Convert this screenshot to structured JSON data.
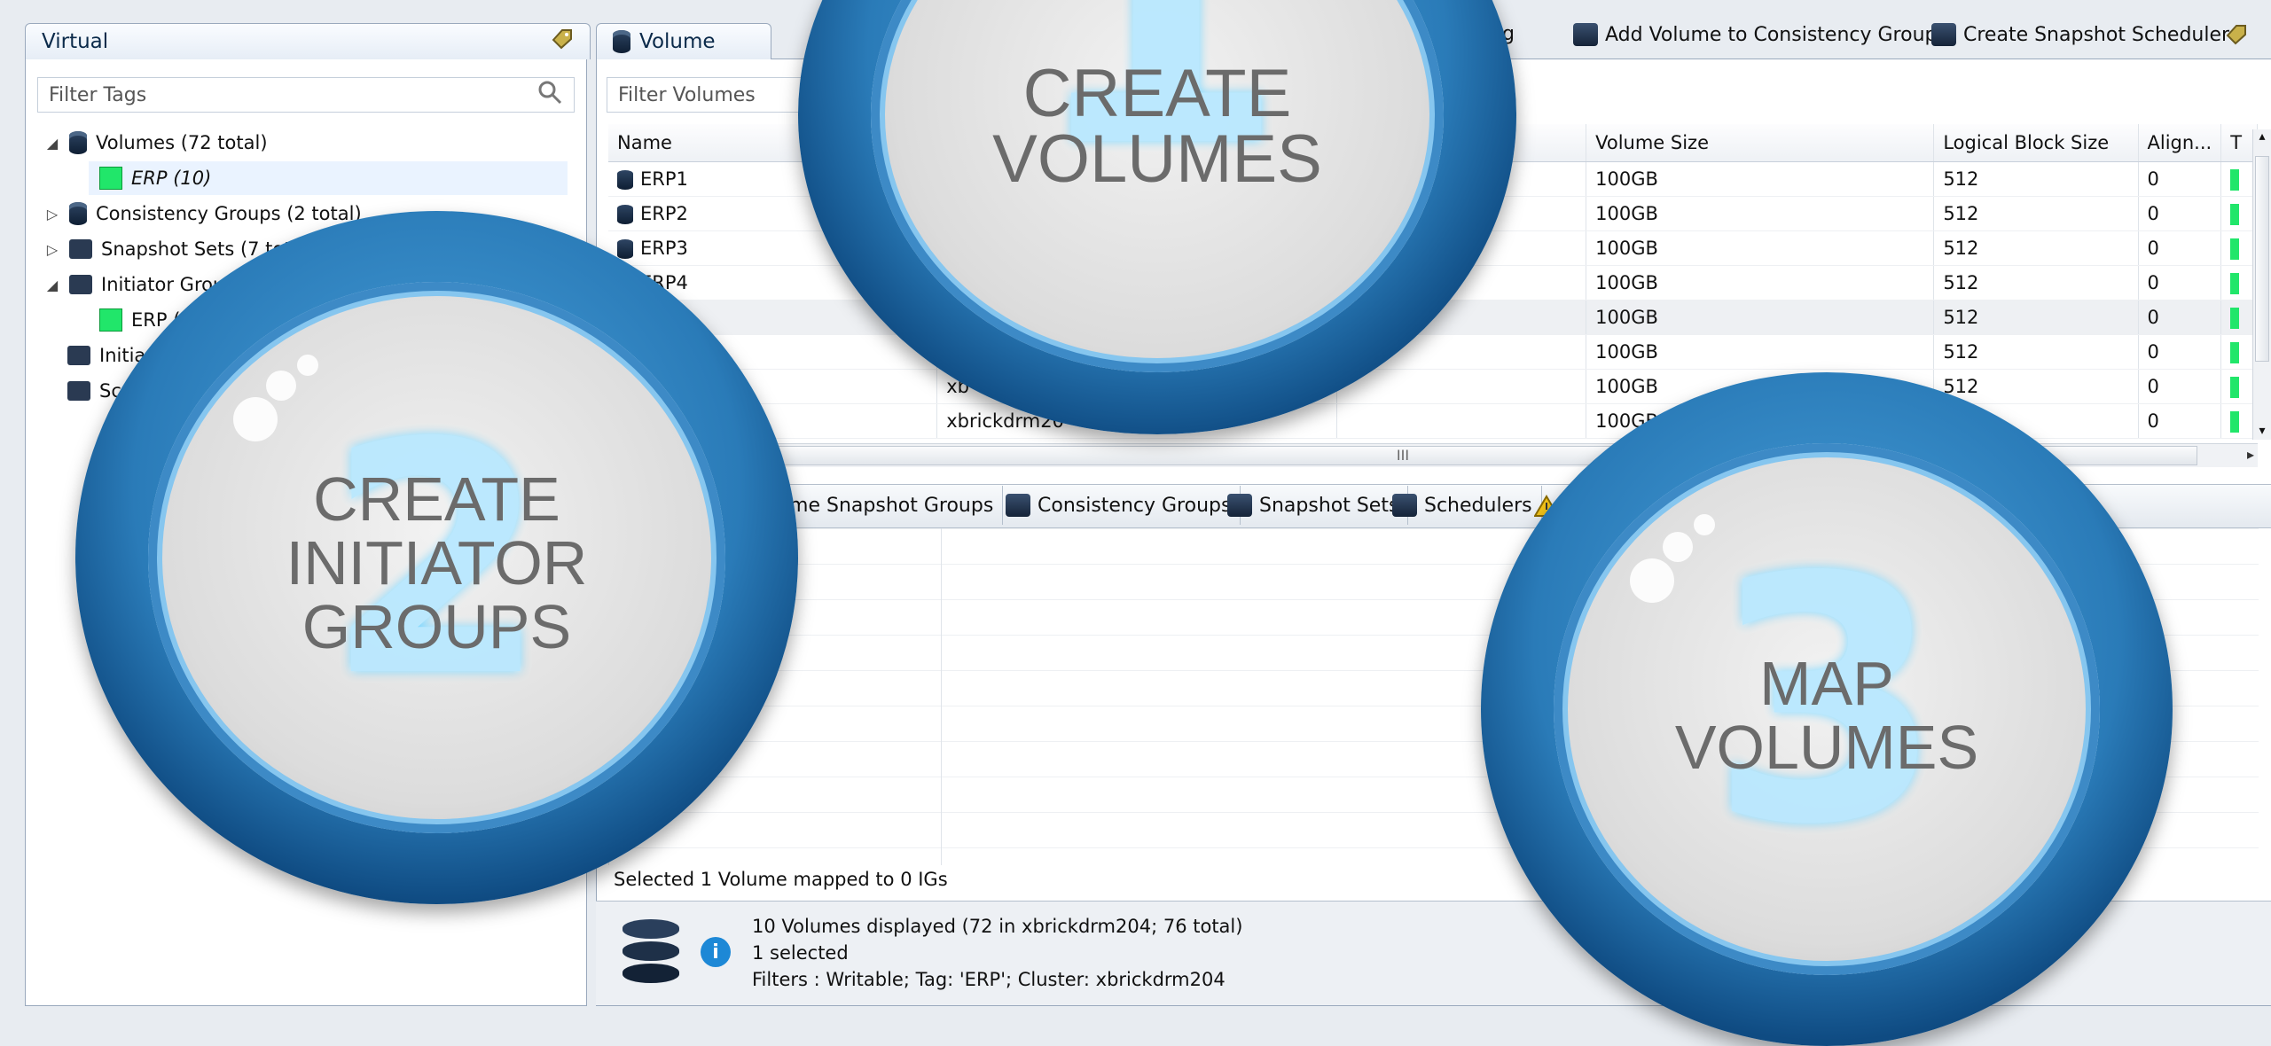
{
  "left_panel": {
    "tab_label": "Virtual",
    "filter_placeholder": "Filter Tags",
    "tree": [
      {
        "label": "Volumes (72 total)",
        "icon": "database-icon",
        "expanded": true
      },
      {
        "label": "ERP (10)",
        "icon": "tag-icon",
        "child": true,
        "selected": true
      },
      {
        "label": "Consistency Groups (2 total)",
        "icon": "consistency-group-icon"
      },
      {
        "label": "Snapshot Sets (7 total)",
        "icon": "snapshot-icon"
      },
      {
        "label": "Initiator Groups",
        "icon": "initiator-group-icon",
        "expanded": true
      },
      {
        "label": "ERP (7",
        "icon": "tag-icon",
        "child": true
      },
      {
        "label": "Initia",
        "icon": "initiator-icon"
      },
      {
        "label": "Sc",
        "icon": "scheduler-icon"
      }
    ]
  },
  "main_panel": {
    "tab_label": "Volume",
    "filter_placeholder": "Filter Volumes",
    "toolbar": [
      {
        "label": "ping",
        "icon": "mapping-icon"
      },
      {
        "label": "Add Volume to Consistency Group",
        "icon": "consistency-group-icon"
      },
      {
        "label": "Create Snapshot Scheduler",
        "icon": "scheduler-icon"
      }
    ],
    "columns": [
      "Name",
      "Volume Size",
      "Logical Block Size",
      "Align...",
      "T"
    ],
    "rows": [
      {
        "name": "ERP1",
        "cluster": "",
        "size": "100GB",
        "lbs": "512",
        "align": "0"
      },
      {
        "name": "ERP2",
        "cluster": "",
        "size": "100GB",
        "lbs": "512",
        "align": "0"
      },
      {
        "name": "ERP3",
        "cluster": "",
        "size": "100GB",
        "lbs": "512",
        "align": "0"
      },
      {
        "name": "ERP4",
        "cluster": "",
        "size": "100GB",
        "lbs": "512",
        "align": "0"
      },
      {
        "name": "",
        "cluster": "",
        "size": "100GB",
        "lbs": "512",
        "align": "0"
      },
      {
        "name": "",
        "cluster": "",
        "size": "100GB",
        "lbs": "512",
        "align": "0"
      },
      {
        "name": "",
        "cluster": "xb",
        "size": "100GB",
        "lbs": "512",
        "align": "0"
      },
      {
        "name": "",
        "cluster": "xbrickdrm20",
        "size": "100GB",
        "lbs": "",
        "align": "0"
      }
    ],
    "scroll_thumb": "III"
  },
  "bottom_panel": {
    "tabs": [
      {
        "label": "lume Snapshot Groups",
        "icon": ""
      },
      {
        "label": "Consistency Groups",
        "icon": "consistency-group-icon"
      },
      {
        "label": "Snapshot Sets",
        "icon": "snapshot-icon"
      },
      {
        "label": "Schedulers",
        "icon": "scheduler-icon"
      }
    ],
    "status": "Selected 1 Volume mapped to 0 IGs"
  },
  "status_bar": {
    "line1": "10 Volumes displayed (72 in xbrickdrm204; 76 total)",
    "line2": "1 selected",
    "line3": "Filters : Writable; Tag: 'ERP'; Cluster: xbrickdrm204"
  },
  "overlays": [
    {
      "number": "1",
      "text_lines": [
        "CREATE",
        "VOLUMES"
      ]
    },
    {
      "number": "2",
      "text_lines": [
        "CREATE",
        "INITIATOR",
        "GROUPS"
      ]
    },
    {
      "number": "3",
      "text_lines": [
        "MAP",
        "VOLUMES"
      ]
    }
  ],
  "colors": {
    "ring_blue": "#2a7bb8",
    "tag_green": "#21e66a",
    "info_blue": "#1d88d6"
  }
}
